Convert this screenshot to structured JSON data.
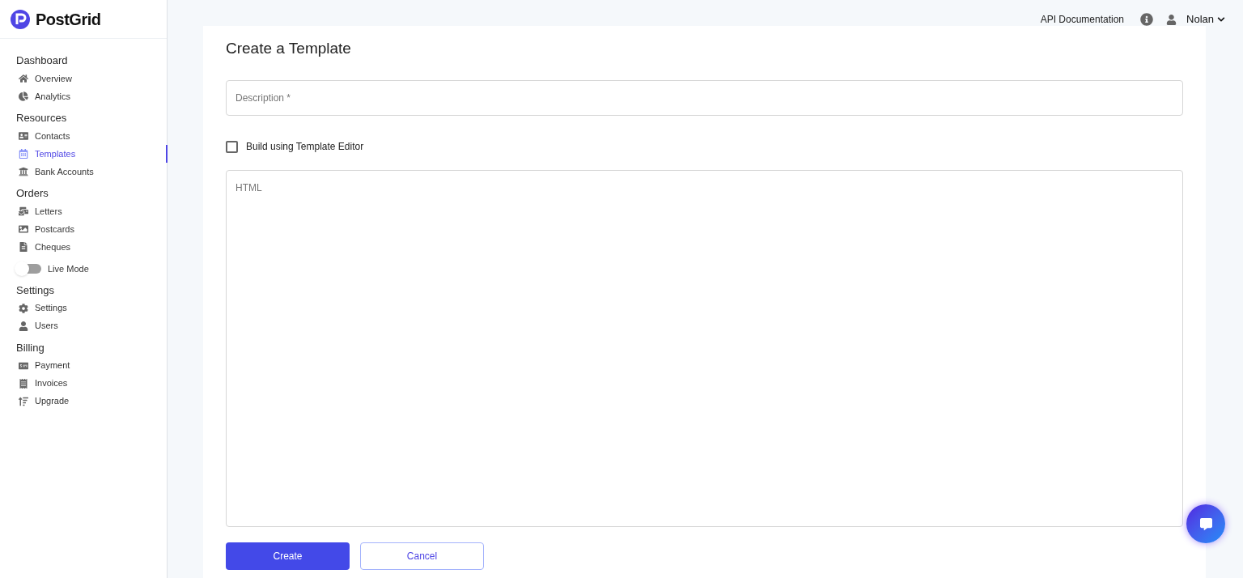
{
  "brand": {
    "name": "PostGrid"
  },
  "sidebar": {
    "sections": [
      {
        "title": "Dashboard",
        "items": [
          {
            "label": "Overview",
            "selected": false
          },
          {
            "label": "Analytics",
            "selected": false
          }
        ]
      },
      {
        "title": "Resources",
        "items": [
          {
            "label": "Contacts",
            "selected": false
          },
          {
            "label": "Templates",
            "selected": true
          },
          {
            "label": "Bank Accounts",
            "selected": false
          }
        ]
      },
      {
        "title": "Orders",
        "items": [
          {
            "label": "Letters",
            "selected": false
          },
          {
            "label": "Postcards",
            "selected": false
          },
          {
            "label": "Cheques",
            "selected": false
          }
        ],
        "toggle": {
          "label": "Live Mode",
          "on": false
        }
      },
      {
        "title": "Settings",
        "items": [
          {
            "label": "Settings",
            "selected": false
          },
          {
            "label": "Users",
            "selected": false
          }
        ]
      },
      {
        "title": "Billing",
        "items": [
          {
            "label": "Payment",
            "selected": false
          },
          {
            "label": "Invoices",
            "selected": false
          },
          {
            "label": "Upgrade",
            "selected": false
          }
        ]
      }
    ]
  },
  "topbar": {
    "link": "API Documentation",
    "user": "Nolan"
  },
  "form": {
    "title": "Create a Template",
    "description": {
      "placeholder": "Description *"
    },
    "editor_checkbox": {
      "label": "Build using Template Editor",
      "checked": false
    },
    "html": {
      "placeholder": "HTML"
    },
    "buttons": [
      {
        "label": "Create",
        "kind": "primary"
      },
      {
        "label": "Cancel",
        "kind": "secondary"
      }
    ]
  }
}
